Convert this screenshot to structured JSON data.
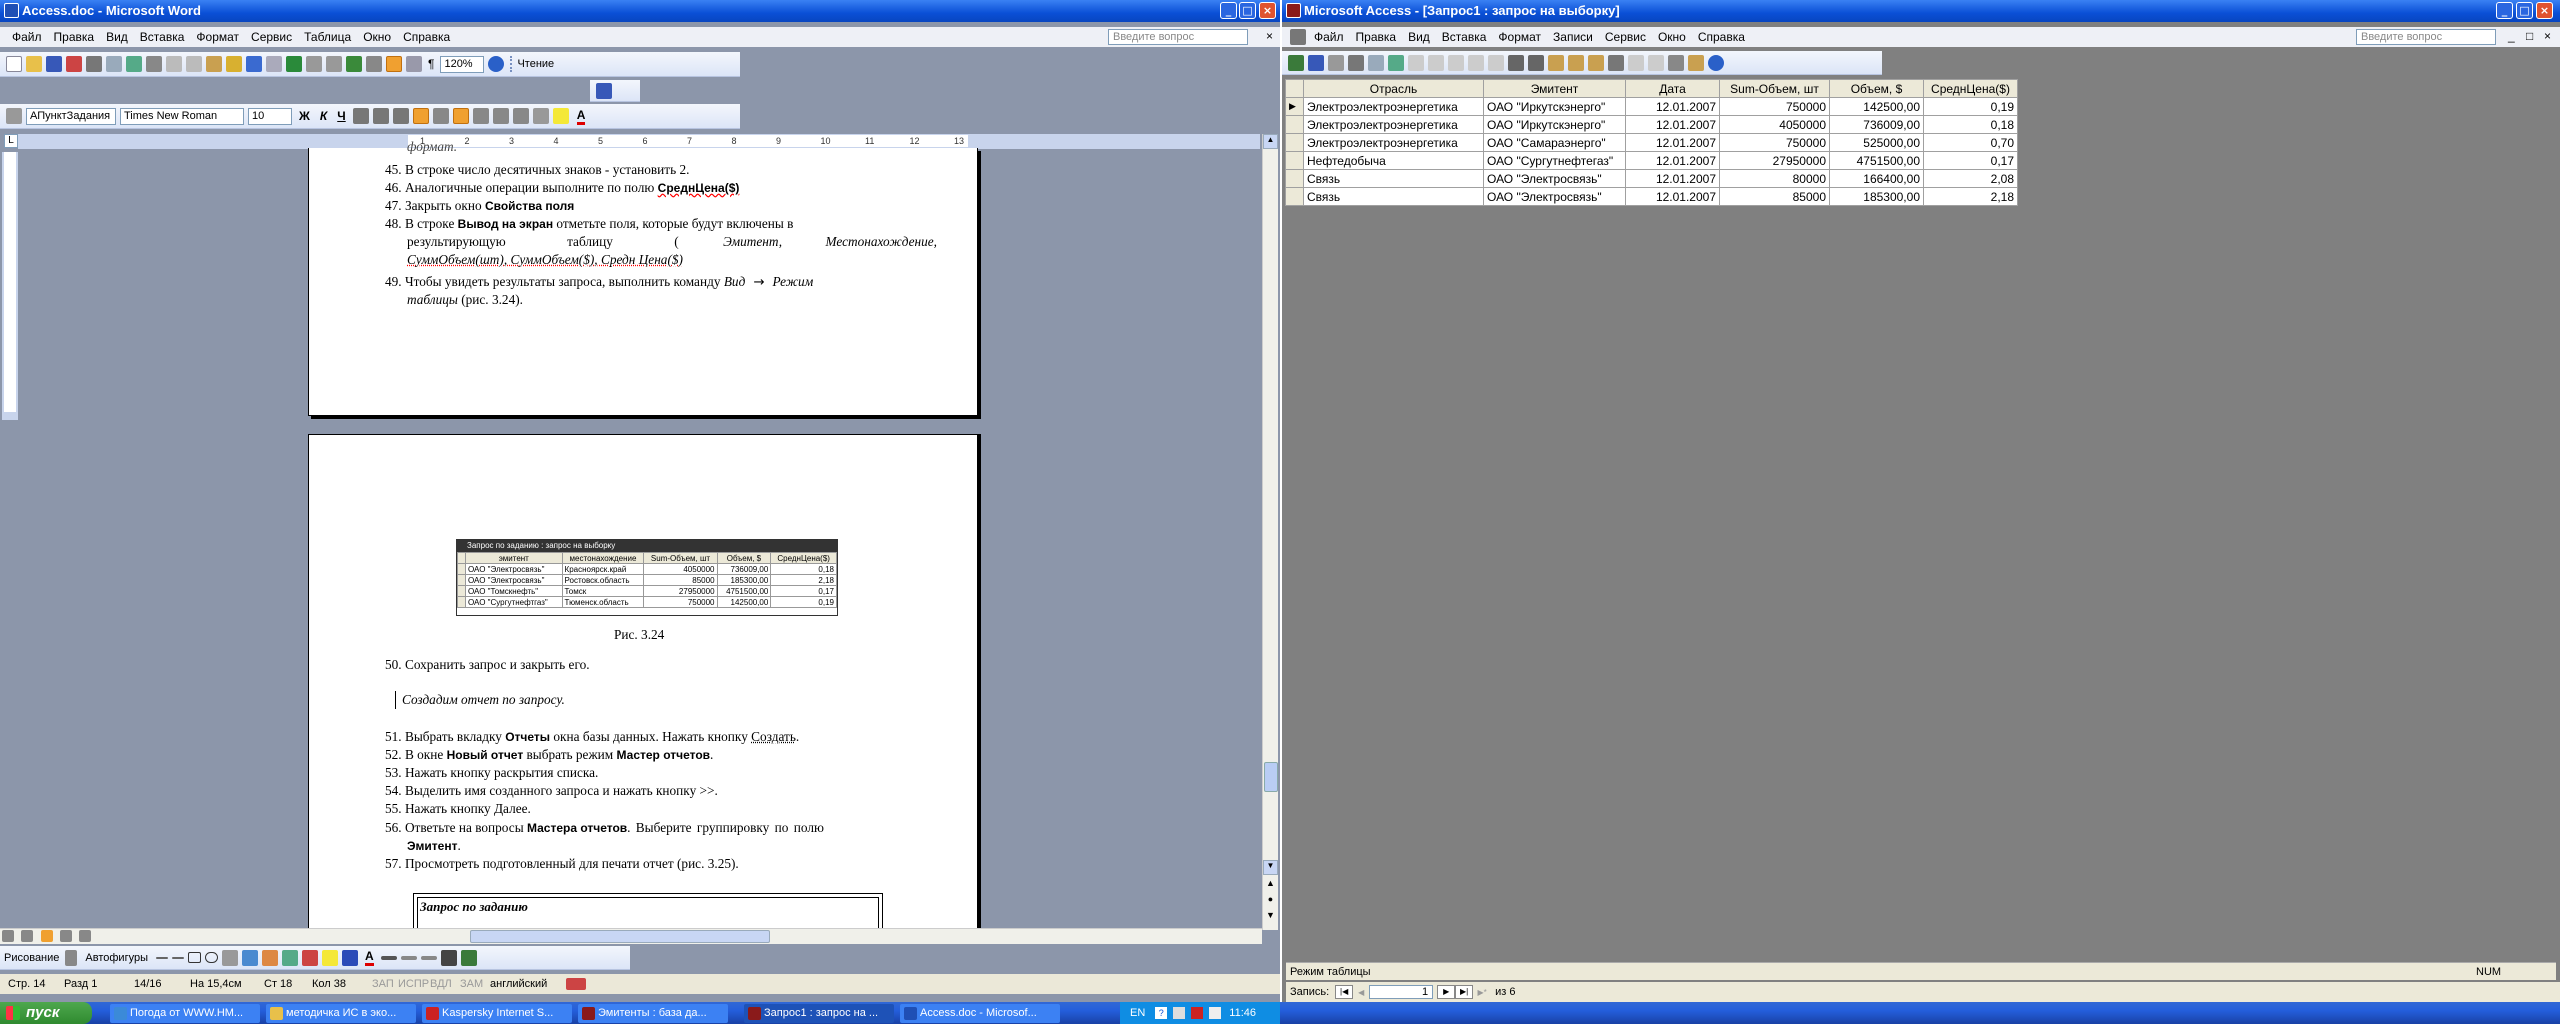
{
  "word": {
    "title": "Access.doc - Microsoft Word",
    "menu": [
      "Файл",
      "Правка",
      "Вид",
      "Вставка",
      "Формат",
      "Сервис",
      "Таблица",
      "Окно",
      "Справка"
    ],
    "ask": "Введите вопрос",
    "zoom": "120%",
    "reading": "Чтение",
    "style": "АПунктЗадания",
    "font": "Times New Roman",
    "size": "10",
    "ruler_nums": [
      "1",
      "2",
      "3",
      "4",
      "5",
      "6",
      "7",
      "8",
      "9",
      "10",
      "11",
      "12",
      "13"
    ],
    "page1": {
      "partial": "формат.",
      "l45": "45. В строке число десятичных знаков - установить 2.",
      "l46a": "46. Аналогичные операции выполните по полю ",
      "l46b": "СреднЦена($)",
      "l47a": "47. Закрыть окно ",
      "l47b": "Свойства поля",
      "l48a": "48. В строке ",
      "l48b": "Вывод на экран",
      "l48c": " отметьте поля, которые будут включены в",
      "l48d": "результирующую таблицу (",
      "l48e": "Эмитент, Местонахождение,",
      "l48f": "СуммОбъем(шт), СуммОбъем($), Средн Цена($)",
      "l49a": "49. Чтобы увидеть результаты запроса, выполнить команду ",
      "l49b": "Вид",
      "l49c": "Режим",
      "l49d": "таблицы",
      "l49e": " (рис. 3.24)."
    },
    "page2": {
      "fig_title": "Запрос по заданию : запрос на выборку",
      "fig_headers": [
        "эмитент",
        "местонахождение",
        "Sum-Объем, шт",
        "Объем, $",
        "СреднЦена($)"
      ],
      "fig_rows": [
        [
          "ОАО \"Электросвязь\"",
          "Красноярск.край",
          "4050000",
          "736009,00",
          "0,18"
        ],
        [
          "ОАО \"Электросвязь\"",
          "Ростовск.область",
          "85000",
          "185300,00",
          "2,18"
        ],
        [
          "ОАО \"Томскнефть\"",
          "Томск",
          "27950000",
          "4751500,00",
          "0,17"
        ],
        [
          "ОАО \"Сургутнефтгаз\"",
          "Тюменск.область",
          "750000",
          "142500,00",
          "0,19"
        ]
      ],
      "caption": "Рис. 3.24",
      "l50": "50. Сохранить запрос и закрыть его.",
      "italic": "Создадим отчет по запросу.",
      "l51a": "51. Выбрать вкладку ",
      "l51b": "Отчеты",
      "l51c": " окна базы данных. Нажать кнопку ",
      "l51d": "Создать",
      "l52a": "52. В окне ",
      "l52b": "Новый отчет",
      "l52c": " выбрать режим ",
      "l52d": "Мастер отчетов",
      "l53": "53. Нажать кнопку раскрытия списка.",
      "l54": "54. Выделить имя созданного запроса и нажать кнопку >>.",
      "l55": "55. Нажать кнопку Далее.",
      "l56a": "56. Ответьте на вопросы ",
      "l56b": "Мастера отчетов",
      "l56c": ". Выберите группировку по полю",
      "l56d": "Эмитент",
      "l57": "57. Просмотреть подготовленный для печати отчет (рис. 3.25).",
      "report_title": "Запрос по заданию"
    },
    "draw": {
      "label": "Рисование",
      "autoshapes": "Автофигуры"
    },
    "status": [
      "Стр. 14",
      "Разд 1",
      "14/16",
      "На 15,4см",
      "Ст 18",
      "Кол 38",
      "ЗАП",
      "ИСПР",
      "ВДЛ",
      "ЗАМ",
      "английский"
    ]
  },
  "access": {
    "title": "Microsoft Access - [Запрос1 : запрос на выборку]",
    "menu": [
      "Файл",
      "Правка",
      "Вид",
      "Вставка",
      "Формат",
      "Записи",
      "Сервис",
      "Окно",
      "Справка"
    ],
    "ask": "Введите вопрос",
    "columns": [
      "Отрасль",
      "Эмитент",
      "Дата",
      "Sum-Объем, шт",
      "Объем, $",
      "СреднЦена($)"
    ],
    "rows": [
      [
        "Электроэлектроэнергетика",
        "ОАО \"Иркутскэнерго\"",
        "12.01.2007",
        "750000",
        "142500,00",
        "0,19"
      ],
      [
        "Электроэлектроэнергетика",
        "ОАО \"Иркутскэнерго\"",
        "12.01.2007",
        "4050000",
        "736009,00",
        "0,18"
      ],
      [
        "Электроэлектроэнергетика",
        "ОАО \"Самараэнерго\"",
        "12.01.2007",
        "750000",
        "525000,00",
        "0,70"
      ],
      [
        "Нефтедобыча",
        "ОАО \"Сургутнефтегаз\"",
        "12.01.2007",
        "27950000",
        "4751500,00",
        "0,17"
      ],
      [
        "Связь",
        "ОАО \"Электросвязь\"",
        "12.01.2007",
        "80000",
        "166400,00",
        "2,08"
      ],
      [
        "Связь",
        "ОАО \"Электросвязь\"",
        "12.01.2007",
        "85000",
        "185300,00",
        "2,18"
      ]
    ],
    "nav": {
      "label": "Запись:",
      "current": "1",
      "of": "из 6"
    },
    "status": "Режим таблицы",
    "num": "NUM"
  },
  "taskbar": {
    "start": "пуск",
    "tasks": [
      "Погода от WWW.НМ...",
      "методичка ИС в эко...",
      "Kaspersky Internet S...",
      "Эмитенты : база да...",
      "Запрос1 : запрос на ...",
      "Access.doc - Microsof..."
    ],
    "lang": "EN",
    "clock": "11:46"
  },
  "colors": {
    "xp_blue": "#0a4fd6",
    "workspace": "#8c96aa",
    "access_bg": "#808080"
  }
}
